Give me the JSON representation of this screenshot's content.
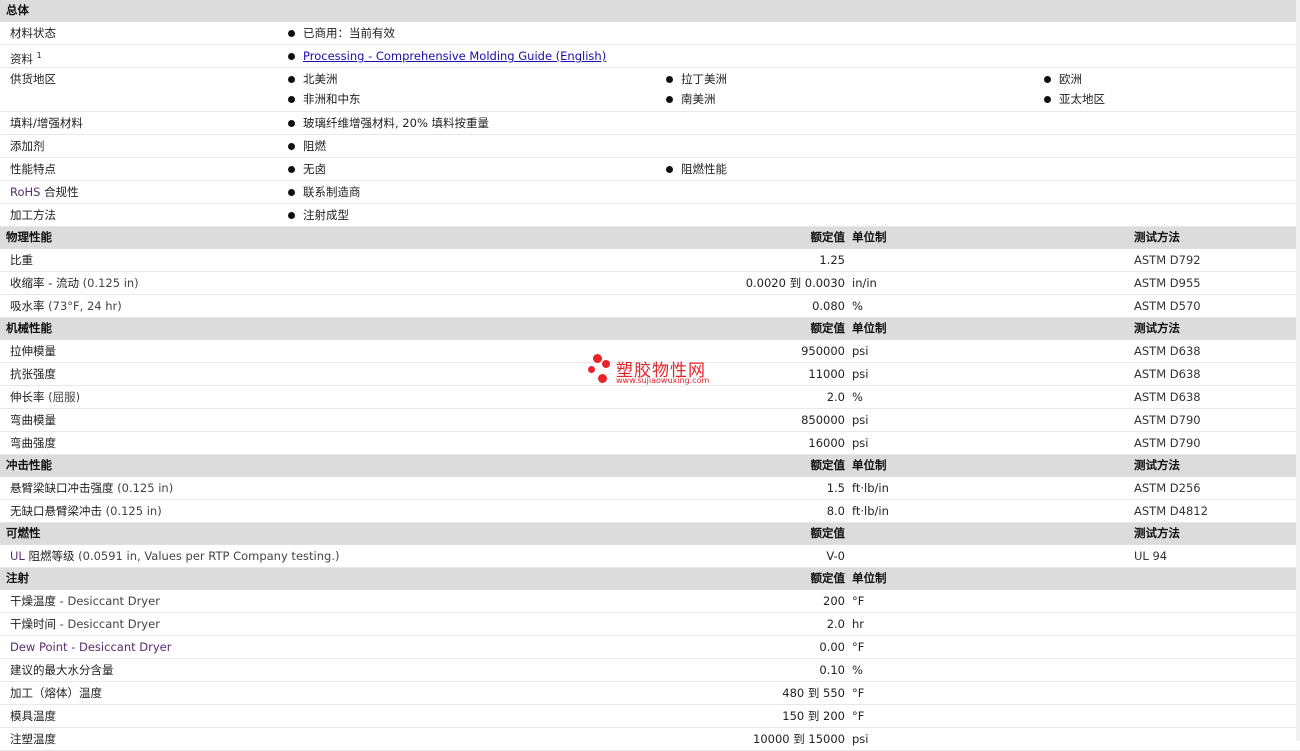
{
  "general": {
    "title": "总体",
    "status_label": "材料状态",
    "status_value": "已商用：当前有效",
    "docs_label": "资料",
    "docs_sup": "1",
    "docs_link": "Processing - Comprehensive Molding Guide (English)",
    "region_label": "供货地区",
    "regions": [
      "北美洲",
      "拉丁美洲",
      "欧洲",
      "非洲和中东",
      "南美洲",
      "亚太地区"
    ],
    "filler_label": "填料/增强材料",
    "filler_value": "玻璃纤维增强材料, 20% 填料按重量",
    "additive_label": "添加剂",
    "additive_value": "阻燃",
    "feature_label": "性能特点",
    "features": [
      "无卤",
      "阻燃性能"
    ],
    "rohs_label_a": "RoHS",
    "rohs_label_b": " 合规性",
    "rohs_value": "联系制造商",
    "process_label": "加工方法",
    "process_value": "注射成型"
  },
  "headers": {
    "rated": "额定值",
    "unit": "单位制",
    "test": "测试方法"
  },
  "physical": {
    "title": "物理性能",
    "rows": [
      {
        "name": "比重",
        "cond": "",
        "value": "1.25",
        "unit": "",
        "test": "ASTM D792"
      },
      {
        "name": "收缩率 - 流动",
        "cond": "(0.125 in)",
        "value": "0.0020 到  0.0030",
        "unit": "in/in",
        "test": "ASTM D955"
      },
      {
        "name": "吸水率",
        "cond": "(73°F, 24 hr)",
        "value": "0.080",
        "unit": "%",
        "test": "ASTM D570"
      }
    ]
  },
  "mechanical": {
    "title": "机械性能",
    "rows": [
      {
        "name": "拉伸模量",
        "cond": "",
        "value": "950000",
        "unit": "psi",
        "test": "ASTM D638"
      },
      {
        "name": "抗张强度",
        "cond": "",
        "value": "11000",
        "unit": "psi",
        "test": "ASTM D638"
      },
      {
        "name": "伸长率",
        "cond": "(屈服)",
        "value": "2.0",
        "unit": "%",
        "test": "ASTM D638"
      },
      {
        "name": "弯曲模量",
        "cond": "",
        "value": "850000",
        "unit": "psi",
        "test": "ASTM D790"
      },
      {
        "name": "弯曲强度",
        "cond": "",
        "value": "16000",
        "unit": "psi",
        "test": "ASTM D790"
      }
    ]
  },
  "impact": {
    "title": "冲击性能",
    "rows": [
      {
        "name": "悬臂梁缺口冲击强度",
        "cond": "(0.125 in)",
        "value": "1.5",
        "unit": "ft·lb/in",
        "test": "ASTM D256"
      },
      {
        "name": "无缺口悬臂梁冲击",
        "cond": "(0.125 in)",
        "value": "8.0",
        "unit": "ft·lb/in",
        "test": "ASTM D4812"
      }
    ]
  },
  "flammability": {
    "title": "可燃性",
    "rows": [
      {
        "name_a": "UL",
        "name_b": " 阻燃等级",
        "cond": "(0.0591 in, Values per RTP Company testing.)",
        "value": "V-0",
        "unit": "",
        "test": "UL 94"
      }
    ]
  },
  "injection": {
    "title": "注射",
    "rows": [
      {
        "name": "干燥温度",
        "cond": "- Desiccant Dryer",
        "value": "200",
        "unit": "°F"
      },
      {
        "name": "干燥时间",
        "cond": "- Desiccant Dryer",
        "value": "2.0",
        "unit": "hr"
      },
      {
        "name": "Dew Point - Desiccant Dryer",
        "cond": "",
        "value": "0.00",
        "unit": "°F"
      },
      {
        "name": "建议的最大水分含量",
        "cond": "",
        "value": "0.10",
        "unit": "%"
      },
      {
        "name": "加工（熔体）温度",
        "cond": "",
        "value": "480 到  550",
        "unit": "°F"
      },
      {
        "name": "模具温度",
        "cond": "",
        "value": "150 到  200",
        "unit": "°F"
      },
      {
        "name": "注塑温度",
        "cond": "",
        "value": "10000 到  15000",
        "unit": "psi"
      }
    ]
  },
  "watermark": {
    "cn": "塑胶物性网",
    "en": "www.sujiaowuxing.com"
  }
}
